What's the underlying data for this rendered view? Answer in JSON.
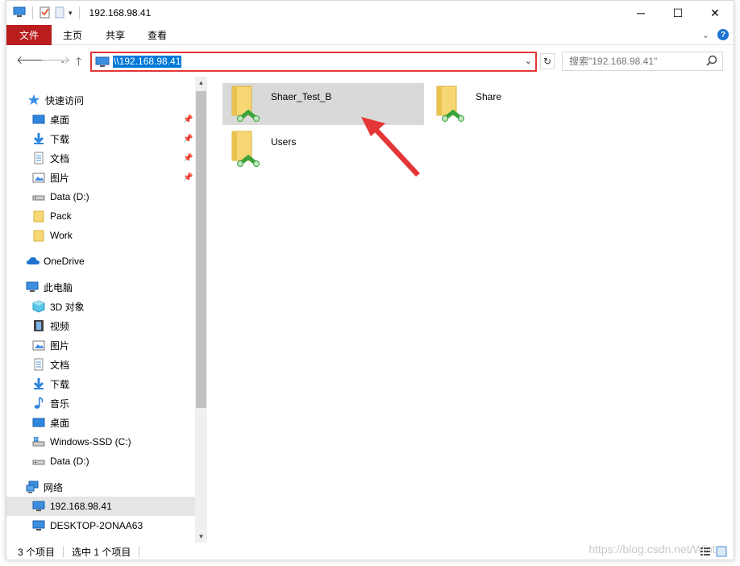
{
  "window": {
    "title": "192.168.98.41",
    "controls": {
      "minimize": "─",
      "maximize": "☐",
      "close": "✕"
    }
  },
  "ribbon": {
    "file_tab": "文件",
    "tabs": [
      "主页",
      "共享",
      "查看"
    ]
  },
  "address_bar": {
    "path": "\\\\192.168.98.41",
    "search_placeholder": "搜索\"192.168.98.41\""
  },
  "nav_pane": {
    "quick_access": "快速访问",
    "quick_items": [
      "桌面",
      "下载",
      "文档",
      "图片",
      "Data (D:)",
      "Pack",
      "Work"
    ],
    "onedrive": "OneDrive",
    "this_pc": "此电脑",
    "pc_items": [
      "3D 对象",
      "视频",
      "图片",
      "文档",
      "下载",
      "音乐",
      "桌面",
      "Windows-SSD (C:)",
      "Data (D:)"
    ],
    "network": "网络",
    "network_items": [
      "192.168.98.41",
      "DESKTOP-2ONAA63"
    ]
  },
  "content": {
    "items": [
      "Shaer_Test_B",
      "Share",
      "Users"
    ]
  },
  "status": {
    "count": "3 个项目",
    "selected": "选中 1 个项目"
  },
  "watermark": "https://blog.csdn.net/Winter",
  "colors": {
    "file_tab": "#b91d1d",
    "selection": "#0078d7",
    "highlight_border": "#e43636",
    "arrow": "#e43636"
  }
}
